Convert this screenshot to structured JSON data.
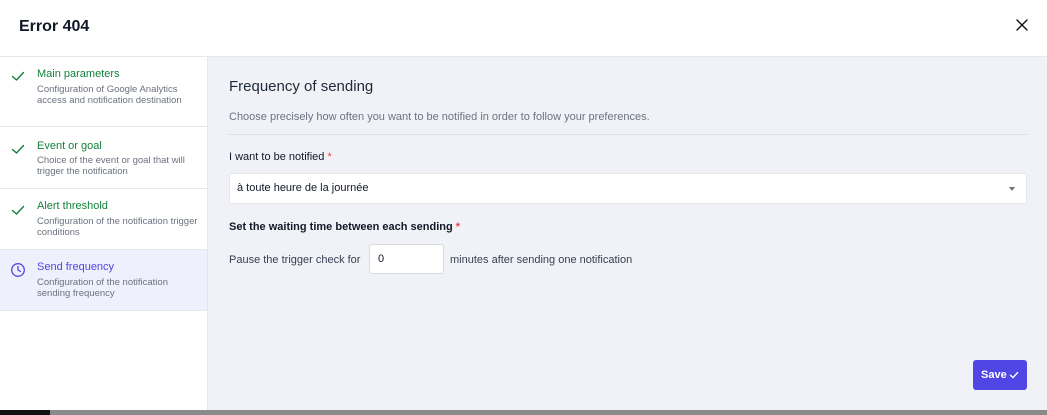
{
  "modal": {
    "title": "Error 404"
  },
  "steps": [
    {
      "label": "Main parameters",
      "desc": "Configuration of Google Analytics access and notification destination",
      "icon": "check-icon",
      "status": "done"
    },
    {
      "label": "Event or goal",
      "desc": "Choice of the event or goal that will trigger the notification",
      "icon": "check-icon",
      "status": "done"
    },
    {
      "label": "Alert threshold",
      "desc": "Configuration of the notification trigger conditions",
      "icon": "check-icon",
      "status": "done"
    },
    {
      "label": "Send frequency",
      "desc": "Configuration of the notification sending frequency",
      "icon": "clock-icon",
      "status": "active"
    }
  ],
  "main": {
    "heading": "Frequency of sending",
    "subtitle": "Choose precisely how often you want to be notified in order to follow your preferences.",
    "notify_label": "I want to be notified",
    "notify_value": "à toute heure de la journée",
    "wait_label": "Set the waiting time between each sending",
    "required_mark": "*",
    "pause_prefix": "Pause the trigger check for",
    "pause_value": "0",
    "pause_suffix": "minutes after sending one notification",
    "save_label": "Save"
  },
  "colors": {
    "accent": "#4f46e5",
    "done": "#15803d",
    "required": "#ef4444"
  }
}
